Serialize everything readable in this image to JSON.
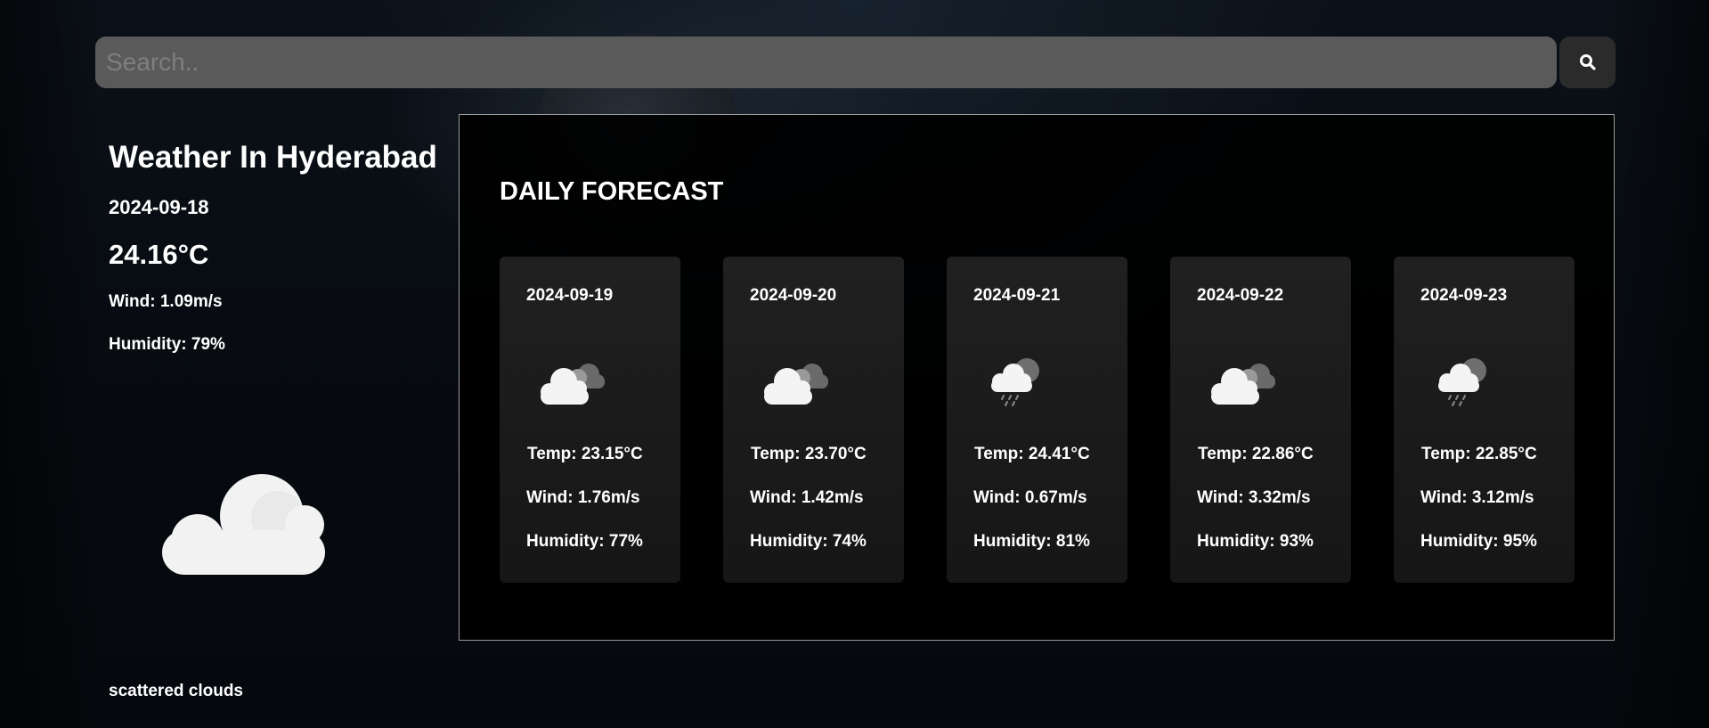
{
  "search": {
    "placeholder": "Search..",
    "value": "",
    "button_icon": "search-icon"
  },
  "current": {
    "title": "Weather In Hyderabad",
    "date": "2024-09-18",
    "temp": "24.16°C",
    "wind": "Wind: 1.09m/s",
    "humidity": "Humidity: 79%",
    "icon": "cloud-icon",
    "description": "scattered clouds"
  },
  "forecast": {
    "title": "DAILY FORECAST",
    "days": [
      {
        "date": "2024-09-19",
        "icon": "broken-clouds-icon",
        "temp": "Temp: 23.15°C",
        "wind": "Wind: 1.76m/s",
        "humidity": "Humidity: 77%"
      },
      {
        "date": "2024-09-20",
        "icon": "broken-clouds-icon",
        "temp": "Temp: 23.70°C",
        "wind": "Wind: 1.42m/s",
        "humidity": "Humidity: 74%"
      },
      {
        "date": "2024-09-21",
        "icon": "rain-cloud-icon",
        "temp": "Temp: 24.41°C",
        "wind": "Wind: 0.67m/s",
        "humidity": "Humidity: 81%"
      },
      {
        "date": "2024-09-22",
        "icon": "broken-clouds-icon",
        "temp": "Temp: 22.86°C",
        "wind": "Wind: 3.32m/s",
        "humidity": "Humidity: 93%"
      },
      {
        "date": "2024-09-23",
        "icon": "rain-cloud-icon",
        "temp": "Temp: 22.85°C",
        "wind": "Wind: 3.12m/s",
        "humidity": "Humidity: 95%"
      }
    ]
  },
  "colors": {
    "search_bg": "#5a5a5a",
    "button_bg": "#2b2b2b",
    "panel_bg": "#000000",
    "card_bg": "#1b1b1b",
    "text": "#ffffff"
  }
}
